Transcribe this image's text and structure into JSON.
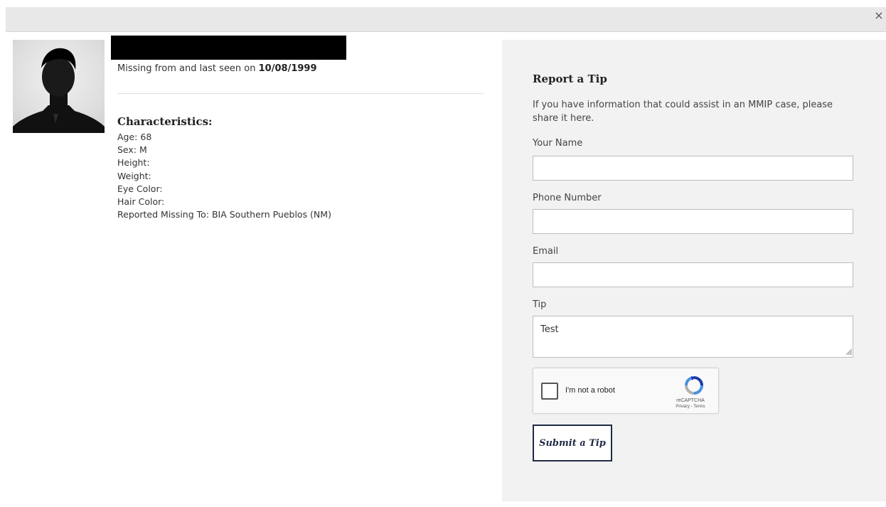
{
  "modal": {
    "close_label": "×"
  },
  "person": {
    "last_seen_prefix": "Missing from and last seen on ",
    "last_seen_date": "10/08/1999",
    "characteristics_title": "Characteristics:",
    "characteristics": [
      "Age: 68",
      "Sex: M",
      "Height:",
      "Weight:",
      "Eye Color:",
      "Hair Color:",
      "Reported Missing To: BIA Southern Pueblos (NM)"
    ]
  },
  "tip_form": {
    "title": "Report a Tip",
    "description": "If you have information that could assist in an MMIP case, please share it here.",
    "name_label": "Your Name",
    "name_value": "",
    "phone_label": "Phone Number",
    "phone_value": "",
    "email_label": "Email",
    "email_value": "",
    "tip_label": "Tip",
    "tip_value": "Test",
    "recaptcha": {
      "label": "I'm not a robot",
      "brand": "reCAPTCHA",
      "terms": "Privacy - Terms"
    },
    "submit_label": "Submit a Tip"
  },
  "colors": {
    "header_bg": "#e8e8e8",
    "panel_bg": "#f2f2f2",
    "button_border": "#1f2b44",
    "redaction": "#000000"
  }
}
